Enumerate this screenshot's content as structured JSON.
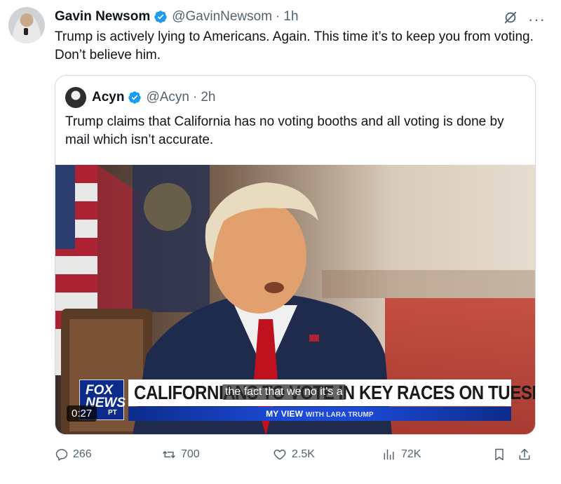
{
  "tweet": {
    "author_name": "Gavin Newsom",
    "author_handle": "@GavinNewsom",
    "separator": "·",
    "time": "1h",
    "text": "Trump is actively lying to Americans. Again. This time it’s to keep you from voting. Don’t believe him.",
    "more_label": "···"
  },
  "quote": {
    "author_name": "Acyn",
    "author_handle": "@Acyn",
    "separator": "·",
    "time": "2h",
    "text": "Trump claims that California has no voting booths and all voting is done by mail which isn’t accurate.",
    "video": {
      "duration": "0:27",
      "caption": "the fact that we no it's a",
      "chyron": "CALIFORNIANS TO VOTE IN KEY RACES ON TUESDAY",
      "subbar_main": "MY VIEW",
      "subbar_small": "WITH LARA TRUMP",
      "logo_top": "FOX",
      "logo_bottom": "NEWS",
      "logo_tag": "PT"
    }
  },
  "actions": {
    "replies": "266",
    "reposts": "700",
    "likes": "2.5K",
    "views": "72K"
  },
  "colors": {
    "verified": "#1d9bf0",
    "muted": "#536471",
    "border": "#cfd9de"
  }
}
